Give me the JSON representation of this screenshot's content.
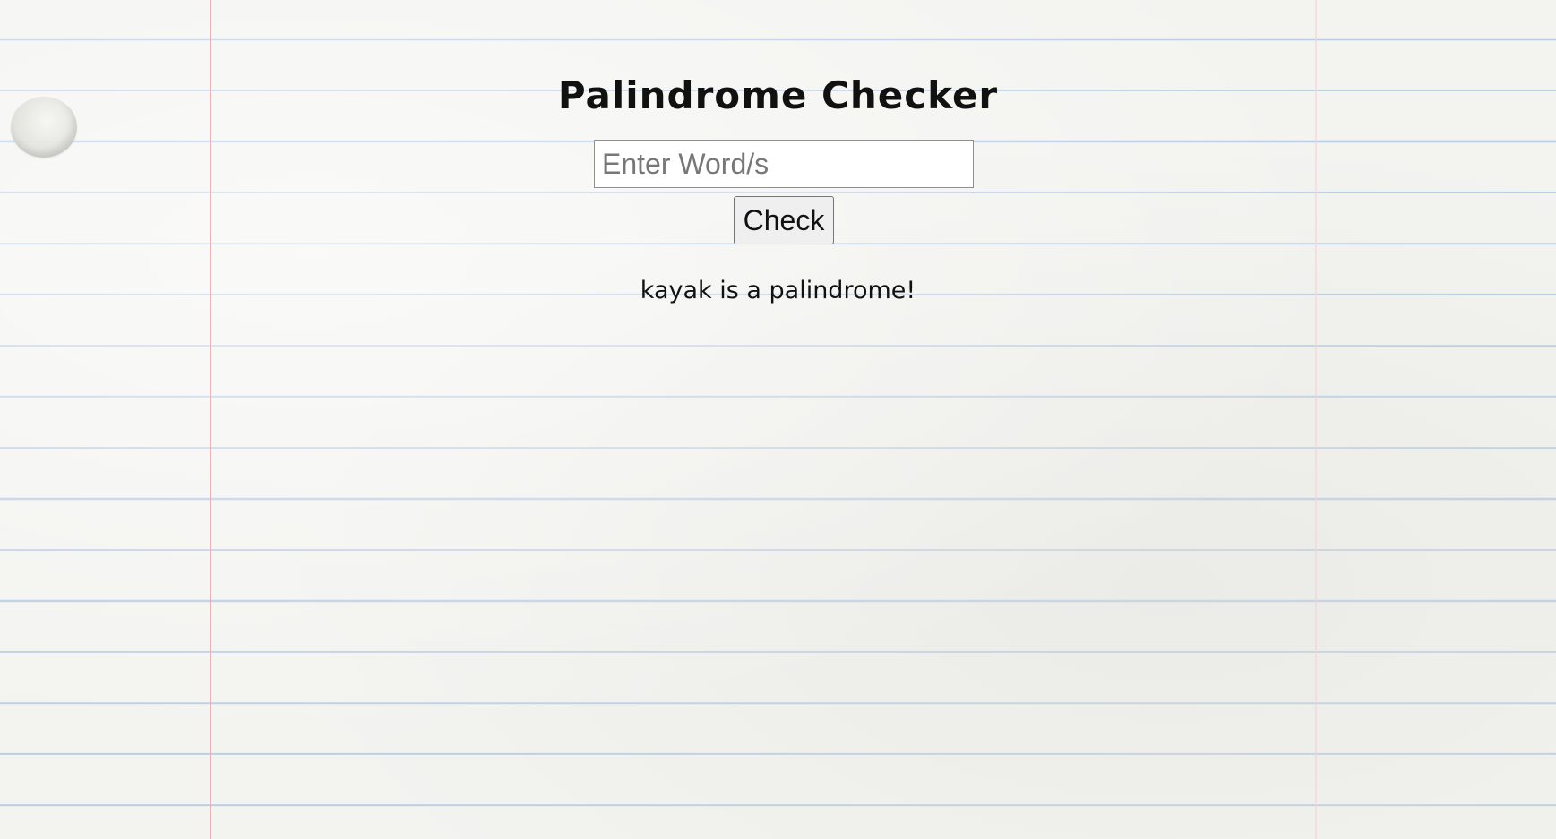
{
  "app": {
    "title": "Palindrome Checker"
  },
  "form": {
    "input_value": "",
    "input_placeholder": "Enter Word/s",
    "check_label": "Check"
  },
  "result": {
    "text": "kayak is a palindrome!"
  },
  "colors": {
    "rule_line": "#b9cde6",
    "margin_line": "#f2a7b3",
    "paper": "#f3f3f0"
  }
}
